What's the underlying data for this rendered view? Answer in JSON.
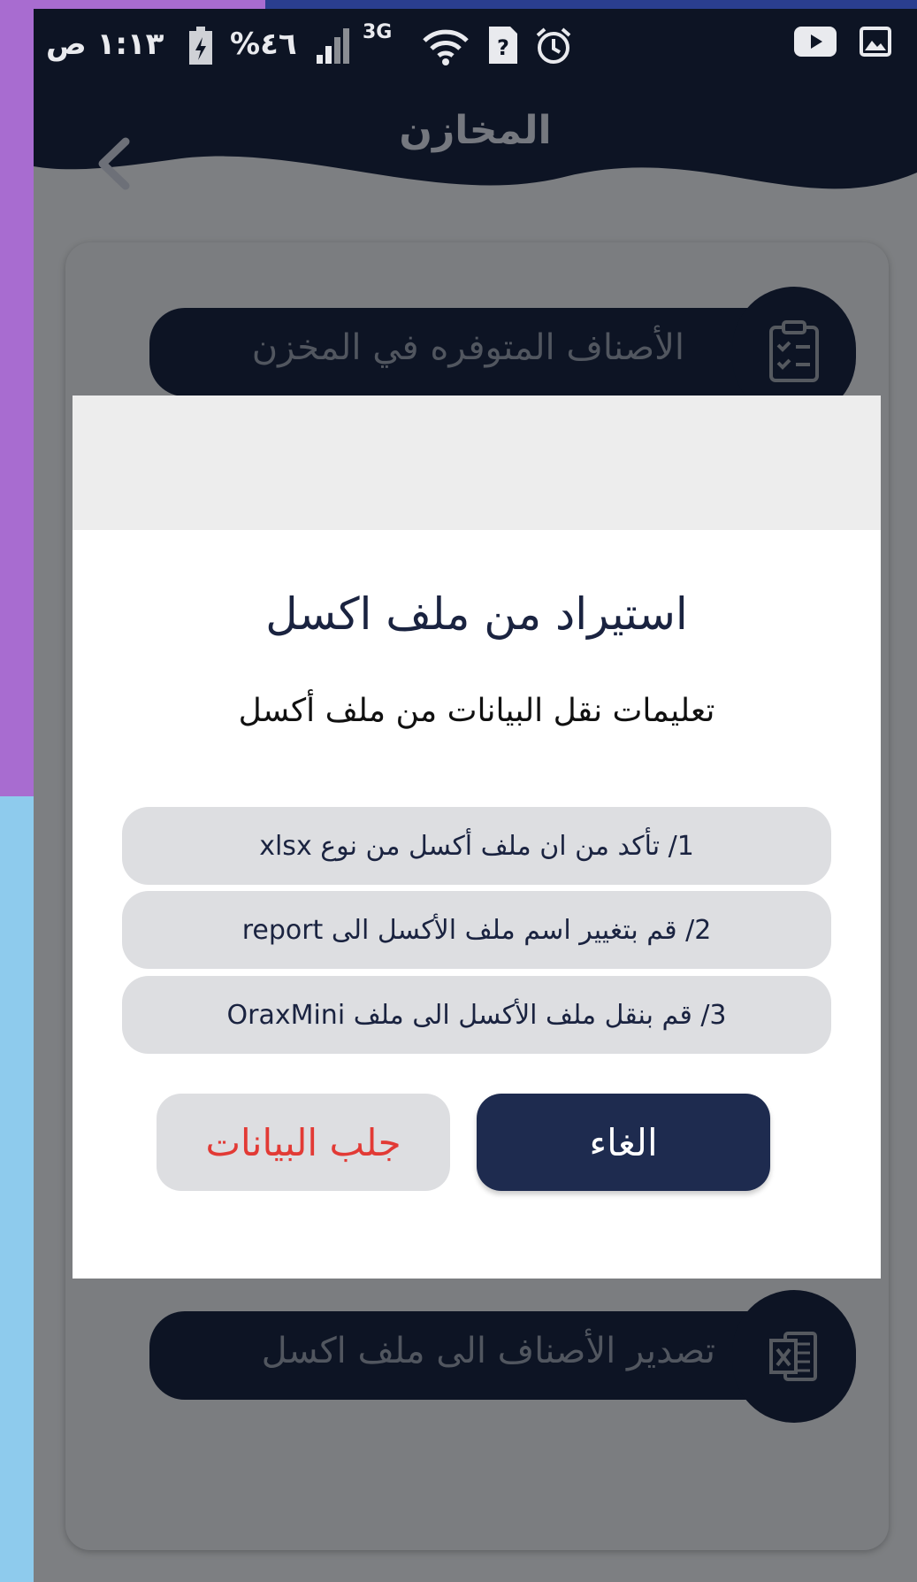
{
  "status_bar": {
    "time": "١:١٣ ص",
    "battery": "%٤٦",
    "network": "3G"
  },
  "header": {
    "title": "المخازن"
  },
  "menu": {
    "available_items": "الأصناف المتوفره في المخزن",
    "export_items": "تصدير الأصناف الى ملف اكسل"
  },
  "dialog": {
    "title": "استيراد من ملف اكسل",
    "subtitle": "تعليمات نقل البيانات من ملف أكسل",
    "steps": [
      "1/ تأكد من ان ملف أكسل من نوع xlsx",
      "2/ قم بتغيير اسم ملف الأكسل الى report",
      "3/ قم بنقل ملف الأكسل الى ملف OraxMini"
    ],
    "fetch_label": "جلب البيانات",
    "cancel_label": "الغاء"
  },
  "colors": {
    "header_bg": "#0d1424",
    "accent_dark": "#1e2b4f",
    "fetch_text": "#e23a35",
    "step_bg": "#dddee1"
  },
  "icons": {
    "back": "chevron-left-icon",
    "clipboard": "clipboard-check-icon",
    "excel": "excel-file-icon"
  }
}
